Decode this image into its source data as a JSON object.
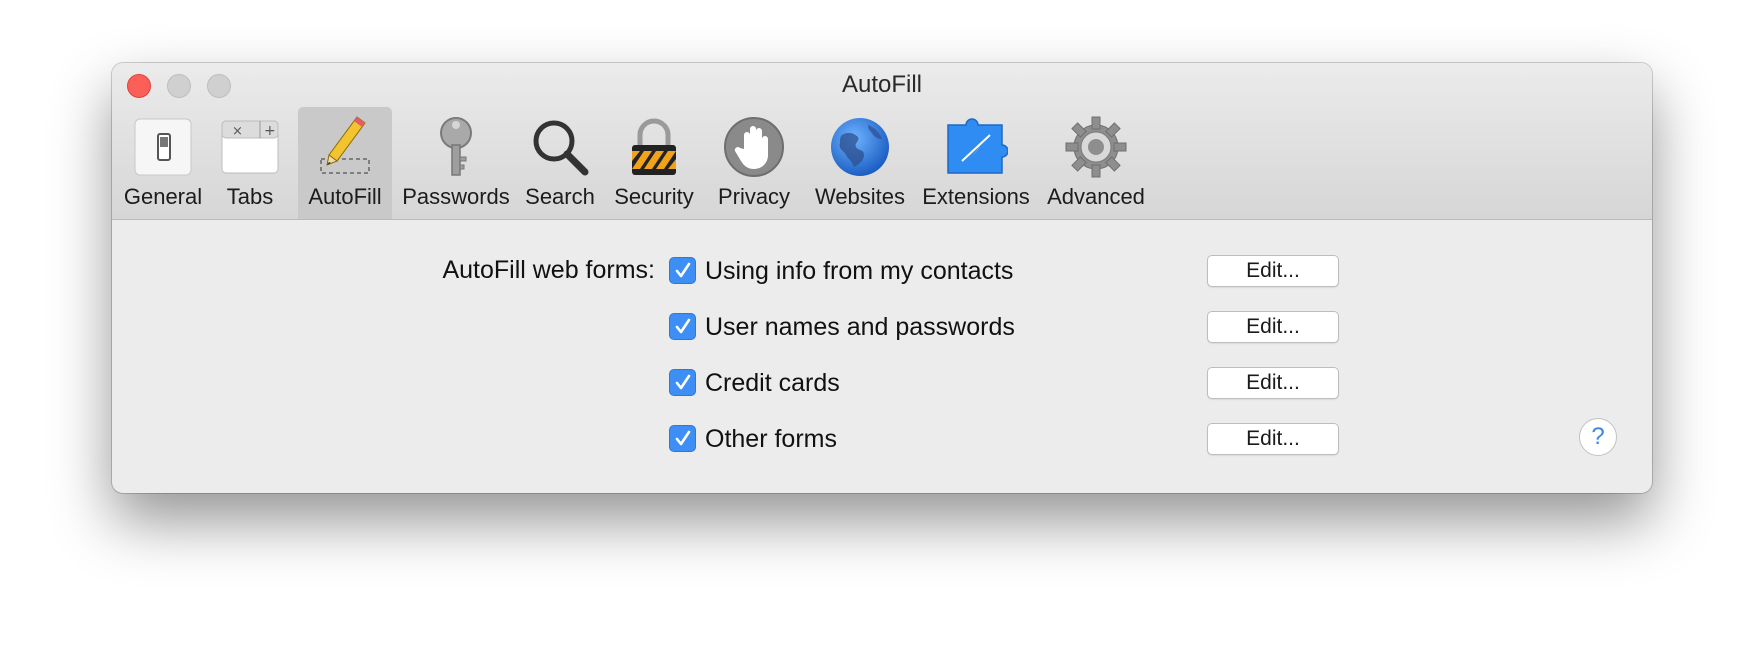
{
  "window": {
    "title": "AutoFill"
  },
  "toolbar": {
    "items": [
      {
        "label": "General",
        "icon": "general-switch-icon"
      },
      {
        "label": "Tabs",
        "icon": "tabs-icon"
      },
      {
        "label": "AutoFill",
        "icon": "pencil-icon",
        "selected": true
      },
      {
        "label": "Passwords",
        "icon": "key-icon"
      },
      {
        "label": "Search",
        "icon": "magnifier-icon"
      },
      {
        "label": "Security",
        "icon": "padlock-icon"
      },
      {
        "label": "Privacy",
        "icon": "hand-icon"
      },
      {
        "label": "Websites",
        "icon": "globe-icon"
      },
      {
        "label": "Extensions",
        "icon": "puzzle-compass-icon"
      },
      {
        "label": "Advanced",
        "icon": "gear-icon"
      }
    ]
  },
  "autofill": {
    "label": "AutoFill web forms:",
    "options": [
      {
        "label": "Using info from my contacts",
        "checked": true,
        "button": "Edit..."
      },
      {
        "label": "User names and passwords",
        "checked": true,
        "button": "Edit..."
      },
      {
        "label": "Credit cards",
        "checked": true,
        "button": "Edit..."
      },
      {
        "label": "Other forms",
        "checked": true,
        "button": "Edit..."
      }
    ]
  },
  "help": {
    "label": "?"
  },
  "colors": {
    "accent": "#3d8ff6",
    "close": "#fc5f57",
    "selected_tab": "#c9c9c9"
  }
}
